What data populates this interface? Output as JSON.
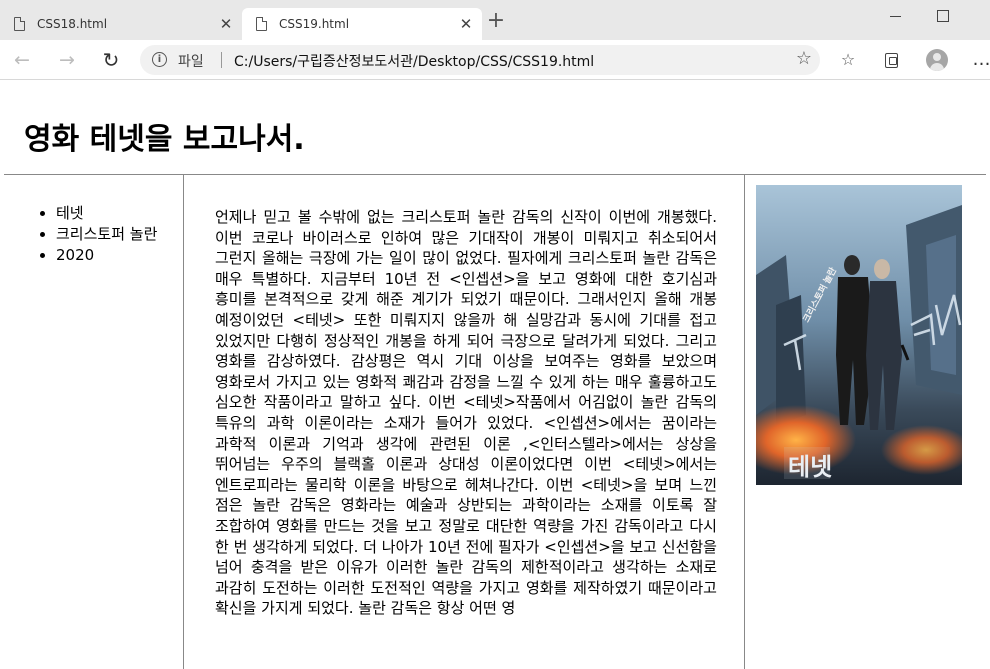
{
  "browser": {
    "tabs": [
      {
        "title": "CSS18.html",
        "close": "✕"
      },
      {
        "title": "CSS19.html",
        "close": "✕"
      }
    ],
    "new_tab": "+",
    "address": {
      "label": "파일",
      "url": "C:/Users/구립증산정보도서관/Desktop/CSS/CSS19.html"
    },
    "icons": [
      "back-icon",
      "forward-icon",
      "reload-icon",
      "info-icon",
      "star-icon",
      "favorites-icon",
      "collections-icon",
      "profile-icon",
      "more-icon"
    ]
  },
  "page": {
    "title": "영화 테넷을 보고나서.",
    "nav": [
      "테넷",
      "크리스토퍼 놀란",
      "2020"
    ],
    "article": "언제나 믿고 볼 수밖에 없는 크리스토퍼 놀란 감독의 신작이 이번에 개봉했다. 이번 코로나 바이러스로 인하여 많은 기대작이 개봉이 미뤄지고 취소되어서 그런지 올해는 극장에 가는 일이 많이 없었다. 필자에게 크리스토퍼 놀란 감독은 매우 특별하다. 지금부터 10년 전 <인셉션>을 보고 영화에 대한 호기심과 흥미를 본격적으로 갖게 해준 계기가 되었기 때문이다. 그래서인지 올해 개봉 예정이었던 <테넷> 또한 미뤄지지 않을까 해 실망감과 동시에 기대를 접고 있었지만 다행히 정상적인 개봉을 하게 되어 극장으로 달려가게 되었다. 그리고 영화를 감상하였다. 감상평은 역시 기대 이상을 보여주는 영화를 보았으며 영화로서 가지고 있는 영화적 쾌감과 감정을 느낄 수 있게 하는 매우 훌륭하고도 심오한 작품이라고 말하고 싶다. 이번 <테넷>작품에서 어김없이 놀란 감독의 특유의 과학 이론이라는 소재가 들어가 있었다. <인셉션>에서는 꿈이라는 과학적 이론과 기억과 생각에 관련된 이론 ,<인터스텔라>에서는 상상을 뛰어넘는 우주의 블랙홀 이론과 상대성 이론이었다면 이번 <테넷>에서는 엔트로피라는 물리학 이론을 바탕으로 헤쳐나간다. 이번 <테넷>을 보며 느낀 점은 놀란 감독은 영화라는 예술과 상반되는 과학이라는 소재를 이토록 잘 조합하여 영화를 만드는 것을 보고 정말로 대단한 역량을 가진 감독이라고 다시 한 번 생각하게 되었다. 더 나아가 10년 전에 필자가 <인셉션>을 보고 신선함을 넘어 충격을 받은 이유가 이러한 놀란 감독의 제한적이라고 생각하는 소재로 과감히 도전하는 이러한 도전적인 역량을 가지고 영화를 제작하였기 때문이라고 확신을 가지게 되었다. 놀란 감독은 항상 어떤 영",
    "poster": {
      "title_art": "TENET",
      "korean_title": "테넷",
      "colors": {
        "sky": "#8fb3cf",
        "city": "#4a5c6e",
        "fire": "#e0652a"
      }
    }
  }
}
